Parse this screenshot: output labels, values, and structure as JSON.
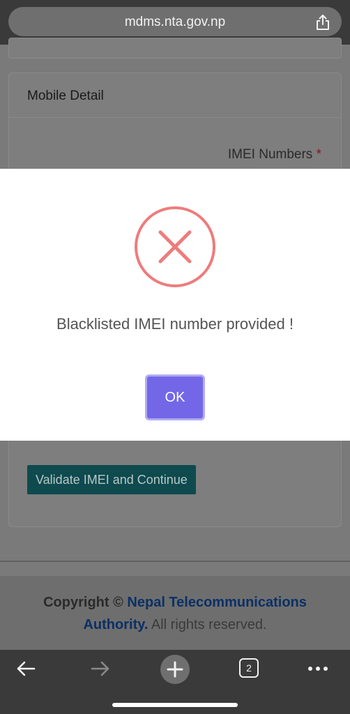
{
  "browser": {
    "url": "mdms.nta.gov.np",
    "tab_count": "2",
    "icons": [
      "share-icon",
      "back-arrow-icon",
      "forward-arrow-icon",
      "new-tab-icon",
      "tabs-icon",
      "more-icon"
    ]
  },
  "card": {
    "title": "Mobile Detail",
    "imei_label": "IMEI Numbers",
    "required_mark": "*",
    "validate_button": "Validate IMEI and Continue"
  },
  "footer": {
    "copyright": "Copyright ©",
    "org_link_line1": "Nepal Telecommunications",
    "org_link_line2": "Authority.",
    "rights": "All rights reserved."
  },
  "modal": {
    "message": "Blacklisted IMEI number provided !",
    "ok_label": "OK",
    "icon": "error-x-icon"
  },
  "colors": {
    "error_red": "#ee7c7c",
    "ok_button": "#7367e8",
    "validate_button": "#0f4a4f",
    "link": "#0b2f66"
  }
}
